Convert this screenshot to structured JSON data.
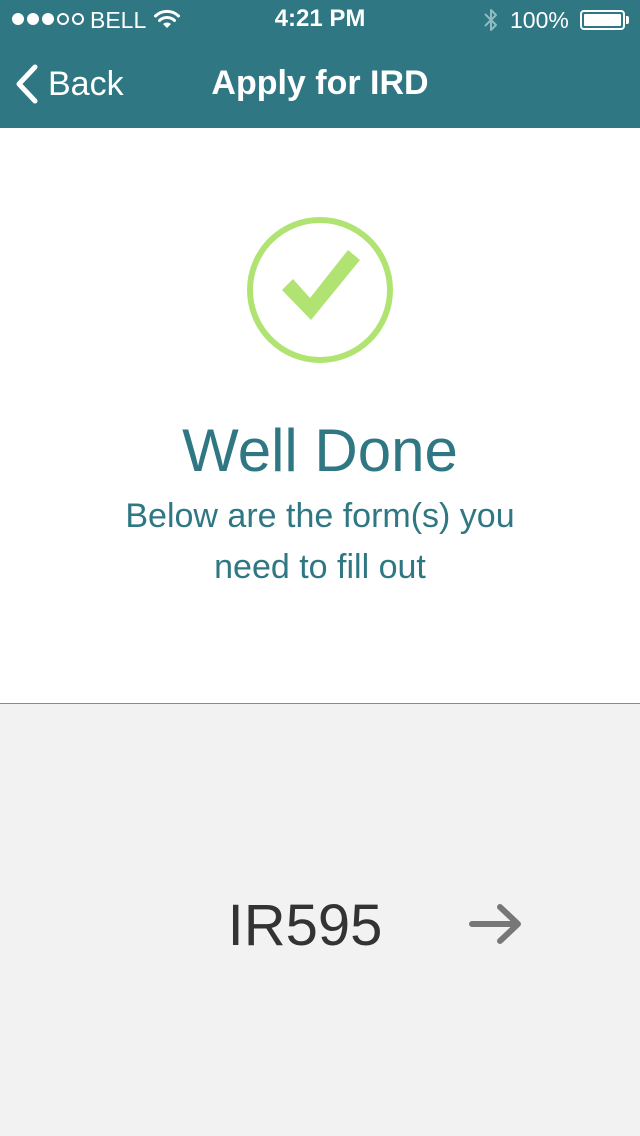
{
  "status_bar": {
    "carrier": "BELL",
    "time": "4:21 PM",
    "battery": "100%",
    "signal_strength": 3,
    "signal_max": 5,
    "battery_level": 1.0
  },
  "nav": {
    "back_label": "Back",
    "title": "Apply for IRD"
  },
  "success": {
    "heading": "Well Done",
    "subtext": "Below are the form(s) you need to fill out",
    "icon": "check-circle-icon"
  },
  "forms": [
    {
      "name": "IR595",
      "icon": "arrow-right-icon"
    }
  ],
  "colors": {
    "brand": "#2e7783",
    "success": "#b1e372",
    "list_background": "#f2f2f2",
    "form_text": "#333333",
    "arrow": "#777777"
  }
}
